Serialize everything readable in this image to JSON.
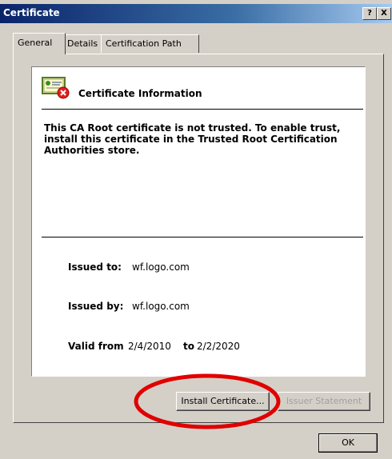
{
  "window": {
    "title": "Certificate",
    "help_glyph": "?",
    "close_glyph": "X"
  },
  "tabs": [
    {
      "label": "General",
      "active": true
    },
    {
      "label": "Details",
      "active": false
    },
    {
      "label": "Certification Path",
      "active": false
    }
  ],
  "info": {
    "title": "Certificate Information",
    "warning": "This CA Root certificate is not trusted. To enable trust, install this certificate in the Trusted Root Certification Authorities store.",
    "issued_to_label": "Issued to:",
    "issued_to_value": "wf.logo.com",
    "issued_by_label": "Issued by:",
    "issued_by_value": "wf.logo.com",
    "valid_from_label": "Valid from",
    "valid_from_value": "2/4/2010",
    "valid_to_label": "to",
    "valid_to_value": "2/2/2020"
  },
  "buttons": {
    "install": "Install Certificate...",
    "issuer": "Issuer Statement",
    "ok": "OK"
  },
  "colors": {
    "highlight": "#e00000",
    "titlebar": "#0a246a",
    "dialog": "#d4d0c8"
  }
}
